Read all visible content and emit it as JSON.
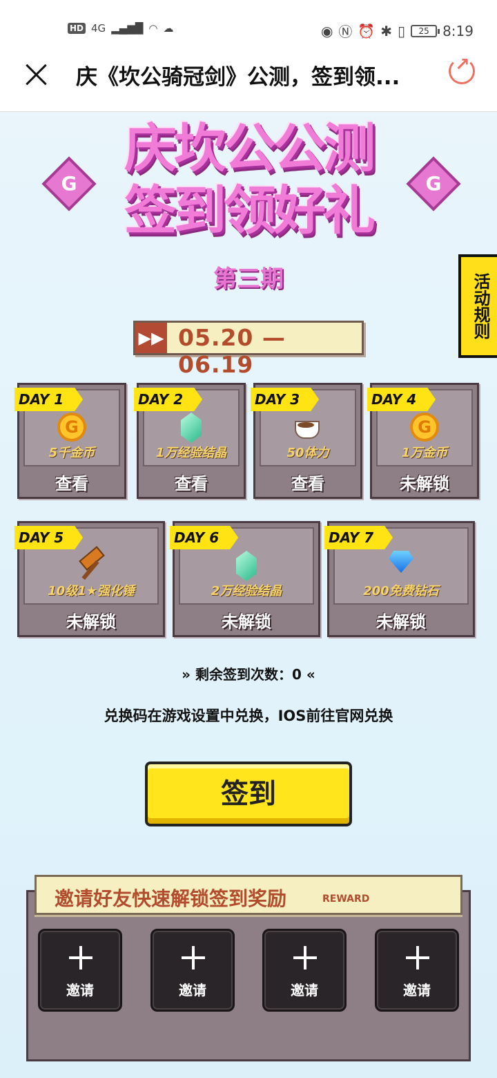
{
  "status_bar": {
    "left_icons": [
      "HD",
      "4G",
      "signal-icon",
      "wifi-icon",
      "cloud-icon"
    ],
    "right_icons": [
      "eye-icon",
      "nfc-icon",
      "alarm-icon",
      "bluetooth-icon",
      "vibrate-icon"
    ],
    "battery": "25",
    "time": "8:19"
  },
  "titlebar": {
    "title": "庆《坎公骑冠剑》公测，签到领..."
  },
  "banner": {
    "line1": "庆坎公公测",
    "line2": "签到领好礼",
    "period": "第三期",
    "date_range": "05.20 — 06.19",
    "rules_tab": "活动规则"
  },
  "days": [
    {
      "tag": "DAY 1",
      "reward": "5千金币",
      "action": "查看",
      "icon": "coin-icon"
    },
    {
      "tag": "DAY 2",
      "reward": "1万经验结晶",
      "action": "查看",
      "icon": "crystal-icon"
    },
    {
      "tag": "DAY 3",
      "reward": "50体力",
      "action": "查看",
      "icon": "coffee-cup-icon"
    },
    {
      "tag": "DAY 4",
      "reward": "1万金币",
      "action": "未解锁",
      "icon": "coin-icon"
    },
    {
      "tag": "DAY 5",
      "reward": "10级1★强化锤",
      "action": "未解锁",
      "icon": "hammer-icon"
    },
    {
      "tag": "DAY 6",
      "reward": "2万经验结晶",
      "action": "未解锁",
      "icon": "crystal-icon"
    },
    {
      "tag": "DAY 7",
      "reward": "200免费钻石",
      "action": "未解锁",
      "icon": "diamond-icon"
    }
  ],
  "coin_letter": "G",
  "remaining": {
    "label": "剩余签到次数：0"
  },
  "exchange_note": "兑换码在游戏设置中兑换，IOS前往官网兑换",
  "sign_button": "签到",
  "invite": {
    "title": "邀请好友快速解锁签到奖励",
    "subtitle": "REWARD",
    "slots": [
      {
        "label": "邀请"
      },
      {
        "label": "邀请"
      },
      {
        "label": "邀请"
      },
      {
        "label": "邀请"
      }
    ]
  },
  "colors": {
    "accent_pink": "#f07cd8",
    "accent_yellow": "#ffe312",
    "brand_brown": "#b24c2d",
    "background": "#e6f4fb"
  }
}
